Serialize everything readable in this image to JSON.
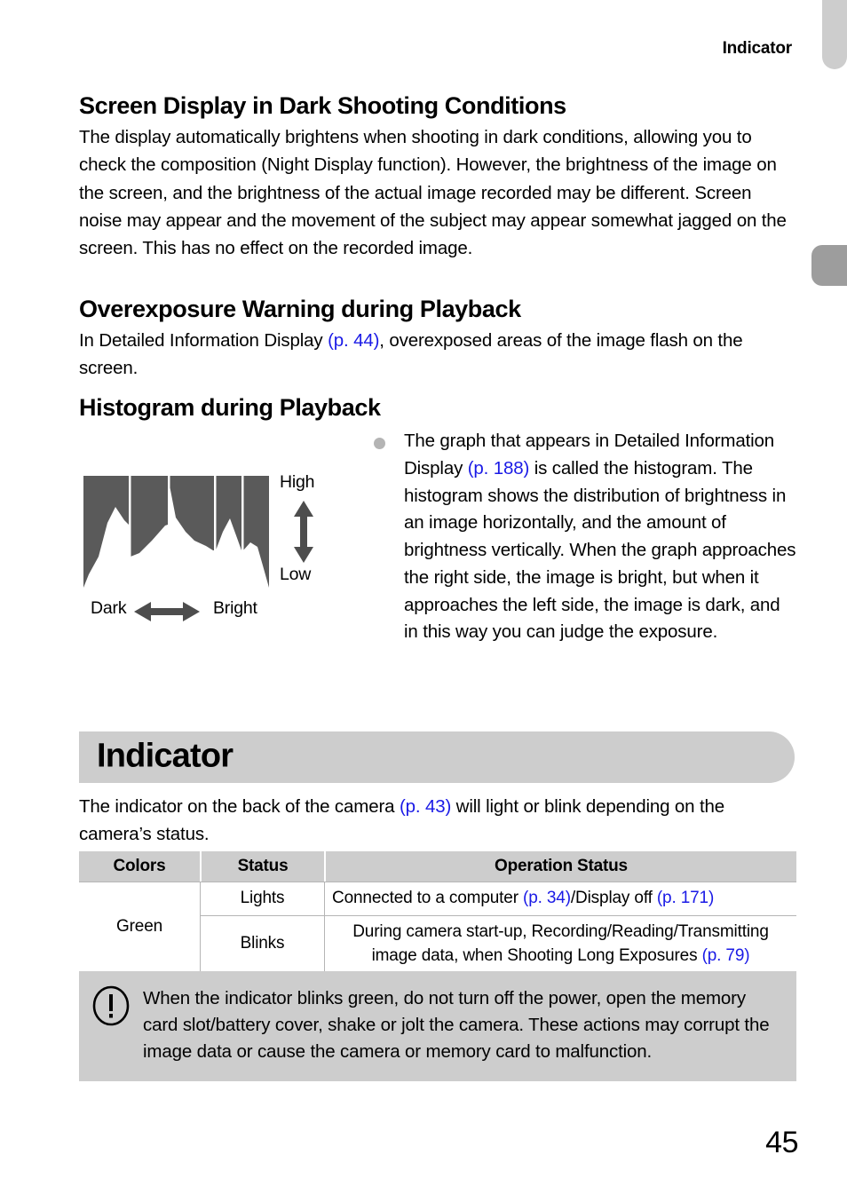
{
  "running_header": "Indicator",
  "page_number": "45",
  "colors": {
    "link": "#1a1ae6",
    "banner_gray": "#cdcdcd",
    "note_gray": "#cdcdcd",
    "histogram_fill": "#5a5a5a",
    "table_header_gray": "#cdcdcd",
    "bullet_gray": "#b4b4b4",
    "arrow_gray": "#4d4d4d"
  },
  "sections": {
    "dark_display": {
      "heading": "Screen Display in Dark Shooting Conditions",
      "body": "The display automatically brightens when shooting in dark conditions, allowing you to check the composition (Night Display function). However, the brightness of the image on the screen, and the brightness of the actual image recorded may be different. Screen noise may appear and the movement of the subject may appear somewhat jagged on the screen. This has no effect on the recorded image."
    },
    "overexposure": {
      "heading": "Overexposure Warning during Playback",
      "body_part1": "In Detailed Information Display ",
      "link1": "(p. 44)",
      "body_part2": ", overexposed areas of the image flash on the screen."
    },
    "histogram": {
      "heading": "Histogram during Playback",
      "figure": {
        "label_high": "High",
        "label_low": "Low",
        "label_dark": "Dark",
        "label_bright": "Bright"
      },
      "bullet": {
        "part1": "The graph that appears in Detailed Information Display ",
        "link1": "(p. 188)",
        "part2": " is called the histogram. The histogram shows the distribution of brightness in an image horizontally, and the amount of brightness vertically. When the graph approaches the right side, the image is bright, but when it approaches the left side, the image is dark, and in this way you can judge the exposure."
      }
    },
    "indicator": {
      "banner_title": "Indicator",
      "body_part1": "The indicator on the back of the camera ",
      "link1": "(p. 43)",
      "body_part2": " will light or blink depending on the camera’s status."
    }
  },
  "table": {
    "headers": [
      "Colors",
      "Status",
      "Operation Status"
    ],
    "rows": [
      {
        "color": "Green",
        "status": "Lights",
        "op_part1": "Connected to a computer ",
        "op_link1": "(p. 34)",
        "op_part2": "/Display off ",
        "op_link2": "(p. 171)",
        "op_part3": ""
      },
      {
        "color": "",
        "status": "Blinks",
        "op_part1": "During camera start-up, Recording/Reading/Transmitting image data, when Shooting Long Exposures ",
        "op_link1": "(p. 79)",
        "op_part2": "",
        "op_link2": "",
        "op_part3": ""
      }
    ]
  },
  "note": {
    "icon": "warning-exclamation-icon",
    "text": "When the indicator blinks green, do not turn off the power, open the memory card slot/battery cover, shake or jolt the camera. These actions may corrupt the image data or cause the camera or memory card to malfunction."
  },
  "chart_data": {
    "type": "area",
    "title": "Histogram during Playback",
    "xlabel_left": "Dark",
    "xlabel_right": "Bright",
    "ylabel_top": "High",
    "ylabel_bottom": "Low",
    "grid": true,
    "gridlines_x": [
      0.25,
      0.46,
      0.71,
      0.86
    ],
    "x": [
      0.0,
      0.03,
      0.08,
      0.13,
      0.17,
      0.22,
      0.245,
      0.25,
      0.255,
      0.3,
      0.37,
      0.44,
      0.455,
      0.46,
      0.465,
      0.5,
      0.55,
      0.6,
      0.66,
      0.7,
      0.705,
      0.71,
      0.715,
      0.75,
      0.79,
      0.83,
      0.855,
      0.86,
      0.865,
      0.9,
      0.94,
      0.97,
      1.0
    ],
    "values": [
      0.0,
      0.12,
      0.28,
      0.58,
      0.72,
      0.6,
      0.56,
      0.56,
      0.28,
      0.32,
      0.42,
      0.54,
      0.56,
      0.56,
      0.9,
      0.63,
      0.5,
      0.42,
      0.37,
      0.33,
      0.33,
      0.33,
      0.33,
      0.5,
      0.62,
      0.45,
      0.33,
      0.33,
      0.33,
      0.4,
      0.36,
      0.2,
      0.0
    ],
    "ylim": [
      0,
      1
    ],
    "xlim": [
      0,
      1
    ]
  }
}
